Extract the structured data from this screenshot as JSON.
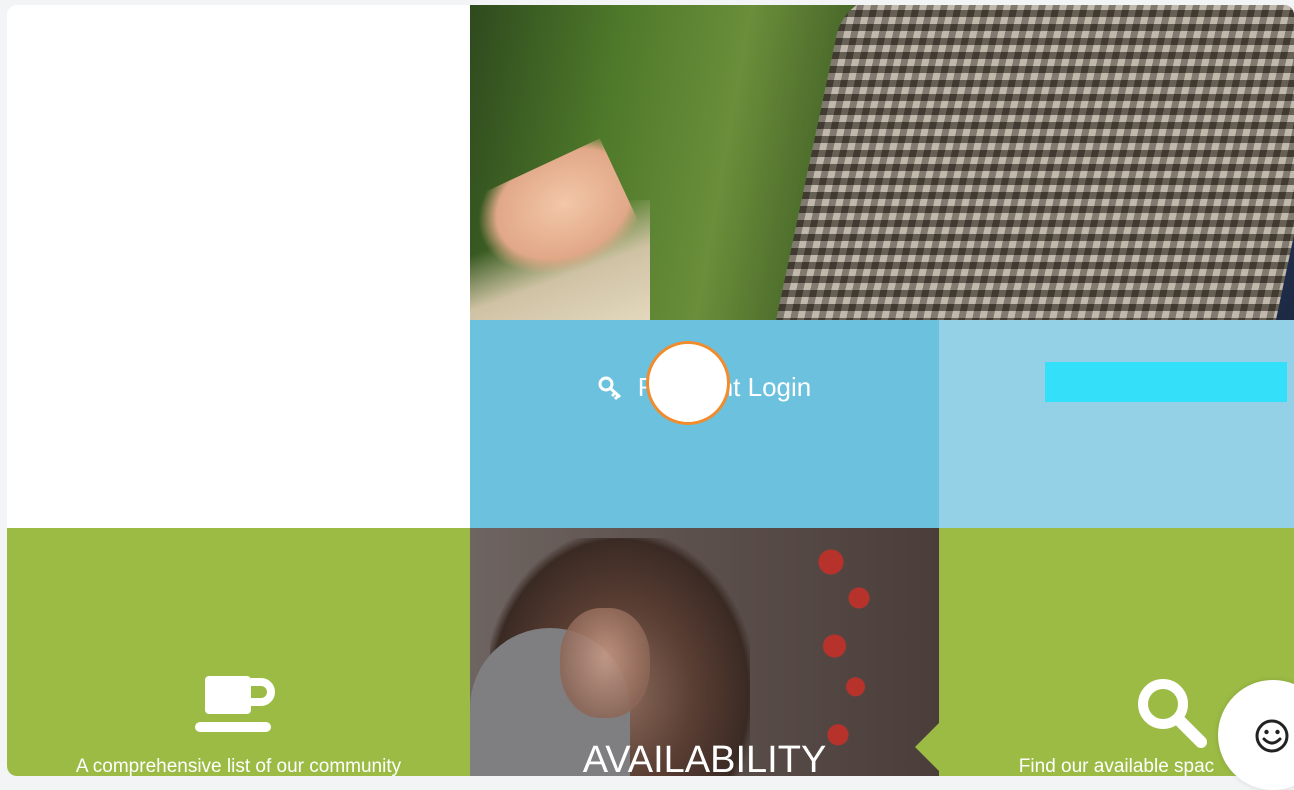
{
  "login": {
    "label": "Resident Login"
  },
  "availability": {
    "title": "AVAILABILITY"
  },
  "community": {
    "text": "A comprehensive list of our community"
  },
  "search": {
    "text": "Find our available spac"
  },
  "colors": {
    "login_tile": "#6bc1de",
    "light_tile": "#94d1e7",
    "green_tile": "#9bbb45",
    "redaction": "#33dff9",
    "click_marker_border": "#f08c2e"
  },
  "icons": {
    "login": "key-icon",
    "community": "cup-icon",
    "search": "search-icon",
    "feedback": "smile-icon"
  }
}
